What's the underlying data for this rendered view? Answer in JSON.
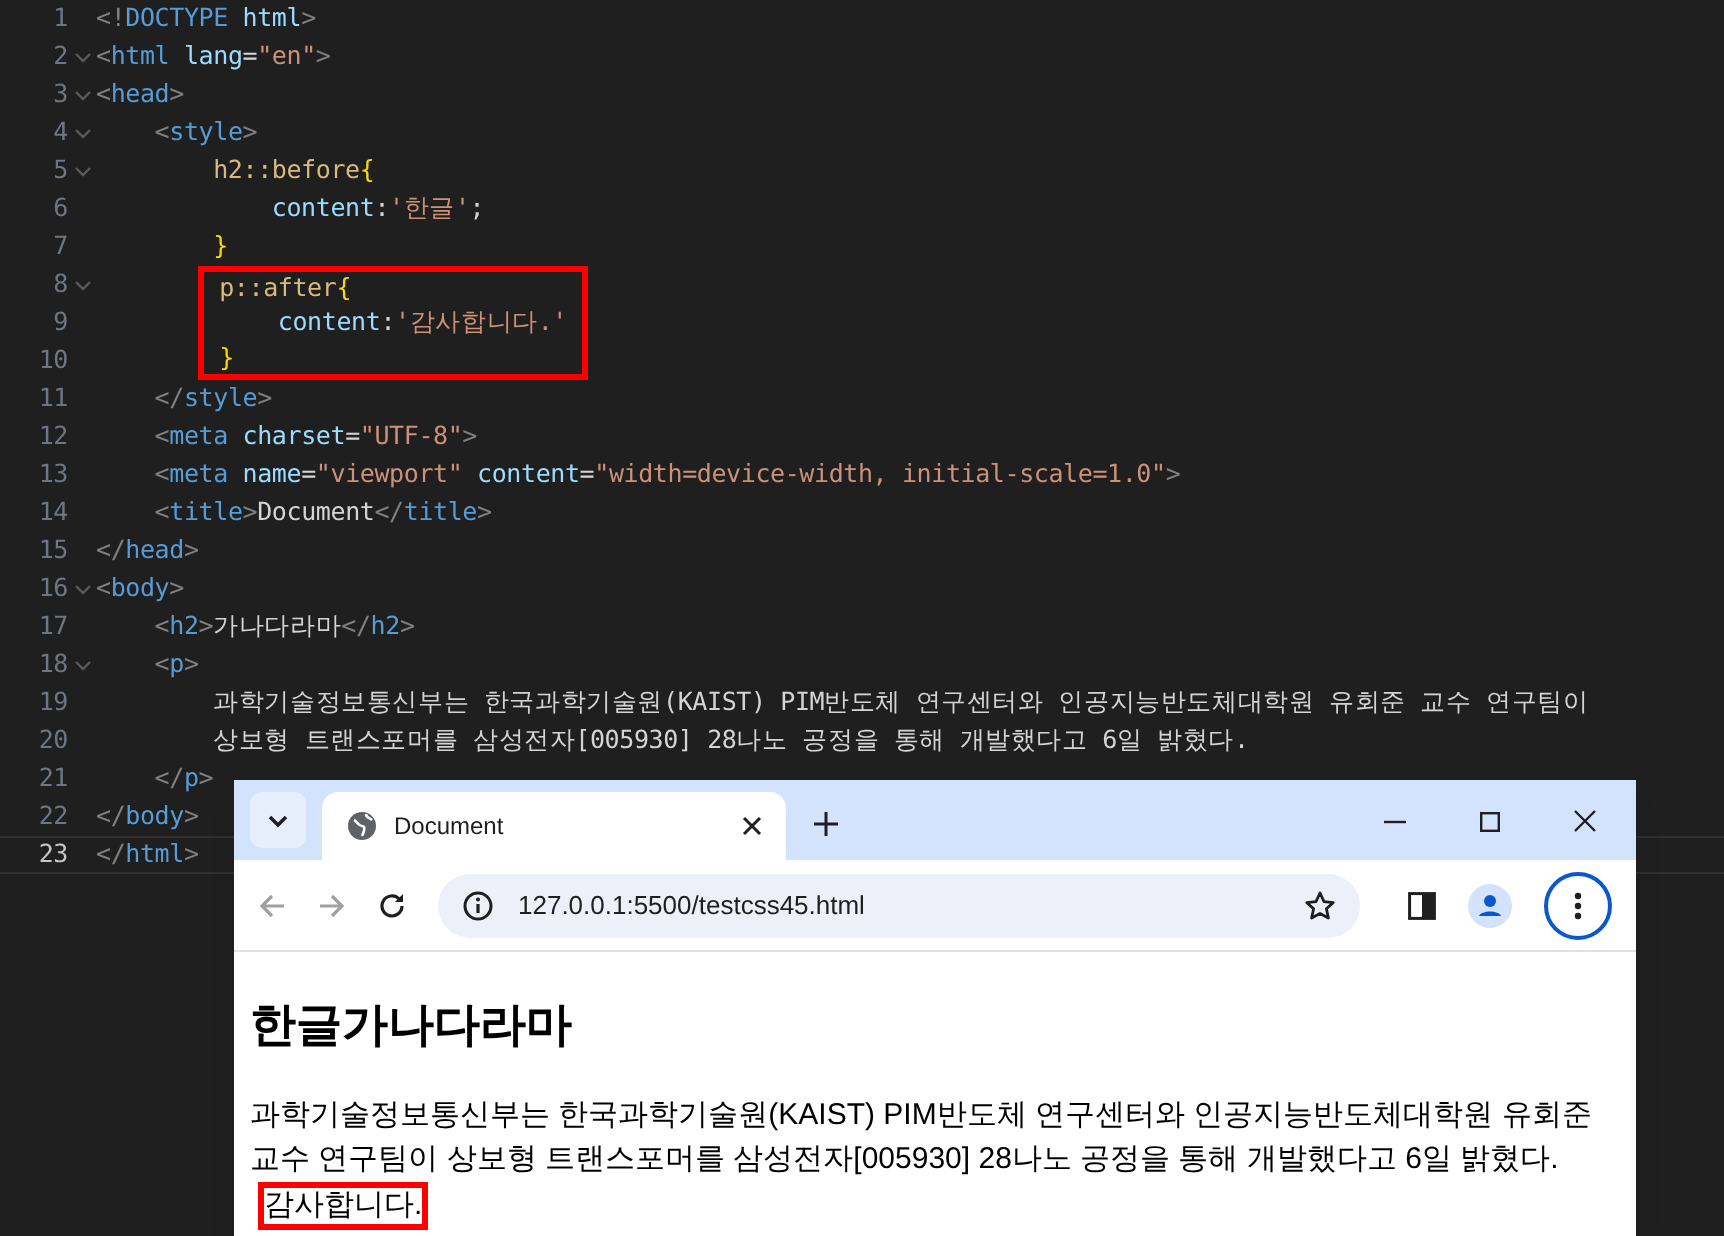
{
  "editor": {
    "lines": [
      {
        "number": "1",
        "foldable": false,
        "current": false,
        "highlighted": false,
        "tokens": [
          {
            "kind": "punct",
            "text": "<!"
          },
          {
            "kind": "tag",
            "text": "DOCTYPE"
          },
          {
            "kind": "attr",
            "text": " html"
          },
          {
            "kind": "punct",
            "text": ">"
          }
        ]
      },
      {
        "number": "2",
        "foldable": true,
        "current": false,
        "highlighted": false,
        "tokens": [
          {
            "kind": "punct",
            "text": "<"
          },
          {
            "kind": "tag",
            "text": "html"
          },
          {
            "kind": "attr",
            "text": " lang"
          },
          {
            "kind": "text",
            "text": "="
          },
          {
            "kind": "string",
            "text": "\"en\""
          },
          {
            "kind": "punct",
            "text": ">"
          }
        ]
      },
      {
        "number": "3",
        "foldable": true,
        "current": false,
        "highlighted": false,
        "tokens": [
          {
            "kind": "punct",
            "text": "<"
          },
          {
            "kind": "tag",
            "text": "head"
          },
          {
            "kind": "punct",
            "text": ">"
          }
        ]
      },
      {
        "number": "4",
        "foldable": true,
        "current": false,
        "highlighted": false,
        "tokens": [
          {
            "kind": "punct",
            "text": "    <"
          },
          {
            "kind": "tag",
            "text": "style"
          },
          {
            "kind": "punct",
            "text": ">"
          }
        ]
      },
      {
        "number": "5",
        "foldable": true,
        "current": false,
        "highlighted": false,
        "tokens": [
          {
            "kind": "selector",
            "text": "        h2::before"
          },
          {
            "kind": "brace",
            "text": "{"
          }
        ]
      },
      {
        "number": "6",
        "foldable": false,
        "current": false,
        "highlighted": false,
        "tokens": [
          {
            "kind": "attr",
            "text": "            content"
          },
          {
            "kind": "text",
            "text": ":"
          },
          {
            "kind": "string",
            "text": "'한글'"
          },
          {
            "kind": "text",
            "text": ";"
          }
        ]
      },
      {
        "number": "7",
        "foldable": false,
        "current": false,
        "highlighted": false,
        "tokens": [
          {
            "kind": "brace",
            "text": "        }"
          }
        ]
      },
      {
        "number": "8",
        "foldable": true,
        "current": false,
        "highlighted": true,
        "tokens": [
          {
            "kind": "selector",
            "text": "        p::after"
          },
          {
            "kind": "brace",
            "text": "{"
          }
        ]
      },
      {
        "number": "9",
        "foldable": false,
        "current": false,
        "highlighted": true,
        "tokens": [
          {
            "kind": "attr",
            "text": "            content"
          },
          {
            "kind": "text",
            "text": ":"
          },
          {
            "kind": "string",
            "text": "'감사합니다.'"
          }
        ]
      },
      {
        "number": "10",
        "foldable": false,
        "current": false,
        "highlighted": true,
        "tokens": [
          {
            "kind": "brace",
            "text": "        }"
          }
        ]
      },
      {
        "number": "11",
        "foldable": false,
        "current": false,
        "highlighted": false,
        "tokens": [
          {
            "kind": "punct",
            "text": "    </"
          },
          {
            "kind": "tag",
            "text": "style"
          },
          {
            "kind": "punct",
            "text": ">"
          }
        ]
      },
      {
        "number": "12",
        "foldable": false,
        "current": false,
        "highlighted": false,
        "tokens": [
          {
            "kind": "punct",
            "text": "    <"
          },
          {
            "kind": "tag",
            "text": "meta"
          },
          {
            "kind": "attr",
            "text": " charset"
          },
          {
            "kind": "text",
            "text": "="
          },
          {
            "kind": "string",
            "text": "\"UTF-8\""
          },
          {
            "kind": "punct",
            "text": ">"
          }
        ]
      },
      {
        "number": "13",
        "foldable": false,
        "current": false,
        "highlighted": false,
        "tokens": [
          {
            "kind": "punct",
            "text": "    <"
          },
          {
            "kind": "tag",
            "text": "meta"
          },
          {
            "kind": "attr",
            "text": " name"
          },
          {
            "kind": "text",
            "text": "="
          },
          {
            "kind": "string",
            "text": "\"viewport\""
          },
          {
            "kind": "attr",
            "text": " content"
          },
          {
            "kind": "text",
            "text": "="
          },
          {
            "kind": "string",
            "text": "\"width=device-width, initial-scale=1.0\""
          },
          {
            "kind": "punct",
            "text": ">"
          }
        ]
      },
      {
        "number": "14",
        "foldable": false,
        "current": false,
        "highlighted": false,
        "tokens": [
          {
            "kind": "punct",
            "text": "    <"
          },
          {
            "kind": "tag",
            "text": "title"
          },
          {
            "kind": "punct",
            "text": ">"
          },
          {
            "kind": "text",
            "text": "Document"
          },
          {
            "kind": "punct",
            "text": "</"
          },
          {
            "kind": "tag",
            "text": "title"
          },
          {
            "kind": "punct",
            "text": ">"
          }
        ]
      },
      {
        "number": "15",
        "foldable": false,
        "current": false,
        "highlighted": false,
        "tokens": [
          {
            "kind": "punct",
            "text": "</"
          },
          {
            "kind": "tag",
            "text": "head"
          },
          {
            "kind": "punct",
            "text": ">"
          }
        ]
      },
      {
        "number": "16",
        "foldable": true,
        "current": false,
        "highlighted": false,
        "tokens": [
          {
            "kind": "punct",
            "text": "<"
          },
          {
            "kind": "tag",
            "text": "body"
          },
          {
            "kind": "punct",
            "text": ">"
          }
        ]
      },
      {
        "number": "17",
        "foldable": false,
        "current": false,
        "highlighted": false,
        "tokens": [
          {
            "kind": "punct",
            "text": "    <"
          },
          {
            "kind": "tag",
            "text": "h2"
          },
          {
            "kind": "punct",
            "text": ">"
          },
          {
            "kind": "text",
            "text": "가나다라마"
          },
          {
            "kind": "punct",
            "text": "</"
          },
          {
            "kind": "tag",
            "text": "h2"
          },
          {
            "kind": "punct",
            "text": ">"
          }
        ]
      },
      {
        "number": "18",
        "foldable": true,
        "current": false,
        "highlighted": false,
        "tokens": [
          {
            "kind": "punct",
            "text": "    <"
          },
          {
            "kind": "tag",
            "text": "p"
          },
          {
            "kind": "punct",
            "text": ">"
          }
        ]
      },
      {
        "number": "19",
        "foldable": false,
        "current": false,
        "highlighted": false,
        "tokens": [
          {
            "kind": "text",
            "text": "        과학기술정보통신부는 한국과학기술원(KAIST) PIM반도체 연구센터와 인공지능반도체대학원 유회준 교수 연구팀이"
          }
        ]
      },
      {
        "number": "20",
        "foldable": false,
        "current": false,
        "highlighted": false,
        "tokens": [
          {
            "kind": "text",
            "text": "        상보형 트랜스포머를 삼성전자[005930] 28나노 공정을 통해 개발했다고 6일 밝혔다."
          }
        ]
      },
      {
        "number": "21",
        "foldable": false,
        "current": false,
        "highlighted": false,
        "tokens": [
          {
            "kind": "punct",
            "text": "    </"
          },
          {
            "kind": "tag",
            "text": "p"
          },
          {
            "kind": "punct",
            "text": ">"
          }
        ]
      },
      {
        "number": "22",
        "foldable": false,
        "current": false,
        "highlighted": false,
        "tokens": [
          {
            "kind": "punct",
            "text": "</"
          },
          {
            "kind": "tag",
            "text": "body"
          },
          {
            "kind": "punct",
            "text": ">"
          }
        ]
      },
      {
        "number": "23",
        "foldable": false,
        "current": true,
        "highlighted": false,
        "tokens": [
          {
            "kind": "punct",
            "text": "</"
          },
          {
            "kind": "tag",
            "text": "html"
          },
          {
            "kind": "punct",
            "text": ">"
          }
        ]
      }
    ]
  },
  "browser": {
    "tabs": [
      {
        "label": "Document",
        "selected": true
      }
    ],
    "url": "127.0.0.1:5500/testcss45.html",
    "page": {
      "heading": "한글가나다라마",
      "paragraph": "과학기술정보통신부는 한국과학기술원(KAIST) PIM반도체 연구센터와 인공지능반도체대학원 유회준 교수 연구팀이 상보형 트랜스포머를 삼성전자[005930] 28나노 공정을 통해 개발했다고 6일 밝혔다.",
      "after_text": "감사합니다."
    }
  }
}
